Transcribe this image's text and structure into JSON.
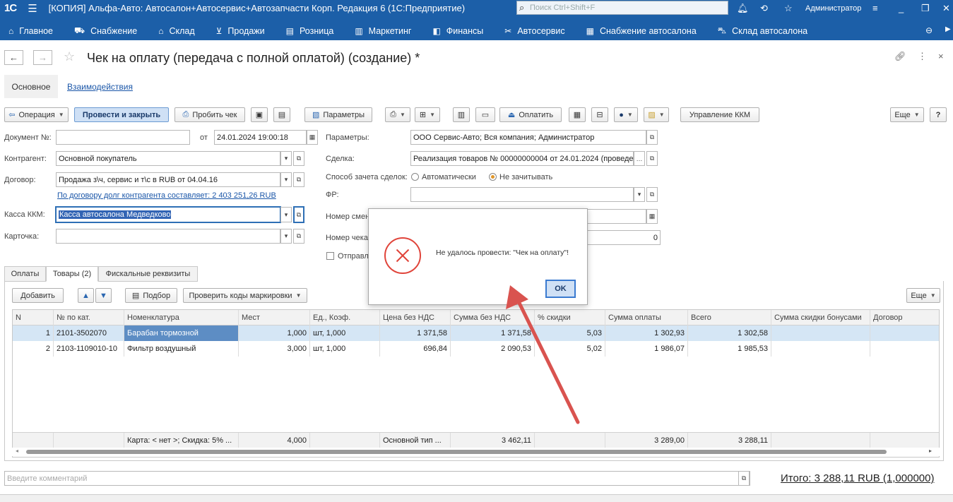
{
  "titlebar": {
    "logo": "1С",
    "title": "[КОПИЯ] Альфа-Авто: Автосалон+Автосервис+Автозапчасти Корп. Редакция 6  (1С:Предприятие)",
    "search_placeholder": "Поиск Ctrl+Shift+F",
    "user": "Администратор"
  },
  "nav": [
    {
      "icon": "home-icon",
      "label": "Главное"
    },
    {
      "icon": "truck-icon",
      "label": "Снабжение"
    },
    {
      "icon": "warehouse-icon",
      "label": "Склад"
    },
    {
      "icon": "cart-icon",
      "label": "Продажи"
    },
    {
      "icon": "register-icon",
      "label": "Розница"
    },
    {
      "icon": "chart-icon",
      "label": "Маркетинг"
    },
    {
      "icon": "finance-icon",
      "label": "Финансы"
    },
    {
      "icon": "tools-icon",
      "label": "Автосервис"
    },
    {
      "icon": "clipboard-icon",
      "label": "Снабжение автосалона"
    },
    {
      "icon": "car-icon",
      "label": "Склад автосалона"
    }
  ],
  "form": {
    "title": "Чек на оплату (передача с полной оплатой) (создание) *",
    "tab_main": "Основное",
    "tab_interactions": "Взаимодействия"
  },
  "toolbar": {
    "operation": "Операция",
    "post_close": "Провести и закрыть",
    "print_check": "Пробить чек",
    "parameters": "Параметры",
    "pay": "Оплатить",
    "kkm": "Управление ККМ",
    "more": "Еще",
    "help": "?"
  },
  "fields": {
    "doc_no_label": "Документ №:",
    "doc_no_value": "",
    "from_label": "от",
    "date_value": "24.01.2024 19:00:18",
    "params_label": "Параметры:",
    "params_value": "ООО Сервис-Авто; Вся компания; Администратор",
    "counterparty_label": "Контрагент:",
    "counterparty_value": "Основной покупатель",
    "deal_label": "Сделка:",
    "deal_value": "Реализация товаров № 00000000004 от 24.01.2024 (проведе",
    "contract_label": "Договор:",
    "contract_value": "Продажа з\\ч, сервис и т\\с в RUB от 04.04.16",
    "debt_link": "По договору долг контрагента составляет: 2 403 251,26 RUB",
    "offset_label": "Способ зачета сделок:",
    "offset_auto": "Автоматически",
    "offset_none": "Не зачитывать",
    "fr_label": "ФР:",
    "fr_value": "",
    "kkm_label": "Касса ККМ:",
    "kkm_value": "Касса автосалона Медведково",
    "shift_label": "Номер смены",
    "card_label": "Карточка:",
    "card_value": "",
    "check_no_label": "Номер чека",
    "check_no_value": "0",
    "send_label": "Отправл"
  },
  "tabs": {
    "payments": "Оплаты",
    "goods": "Товары (2)",
    "fiscal": "Фискальные реквизиты"
  },
  "table_toolbar": {
    "add": "Добавить",
    "pick": "Подбор",
    "check_codes": "Проверить коды маркировки",
    "more": "Еще"
  },
  "table": {
    "columns": [
      "N",
      "№ по кат.",
      "Номенклатура",
      "Мест",
      "Ед., Коэф.",
      "Цена без НДС",
      "Сумма без НДС",
      "% скидки",
      "Сумма оплаты",
      "Всего",
      "Сумма скидки бонусами",
      "Договор"
    ],
    "rows": [
      [
        "1",
        "2101-3502070",
        "Барабан тормозной",
        "1,000",
        "шт, 1,000",
        "1 371,58",
        "1 371,58",
        "5,03",
        "1 302,93",
        "1 302,58",
        "",
        ""
      ],
      [
        "2",
        "2103-1109010-10",
        "Фильтр воздушный",
        "3,000",
        "шт, 1,000",
        "696,84",
        "2 090,53",
        "5,02",
        "1 986,07",
        "1 985,53",
        "",
        ""
      ]
    ],
    "footer": [
      "",
      "",
      "Карта: < нет >; Скидка: 5% ...",
      "4,000",
      "",
      "Основной тип ...",
      "3 462,11",
      "",
      "3 289,00",
      "3 288,11",
      "",
      ""
    ]
  },
  "comment_placeholder": "Введите комментарий",
  "total": "Итого: 3 288,11 RUB (1,000000)",
  "dialog": {
    "message": "Не удалось провести: \"Чек на оплату\"!",
    "ok": "OK"
  },
  "colors": {
    "brand": "#1c5fa8",
    "error": "#e0443a",
    "arrow": "#d9534f"
  }
}
